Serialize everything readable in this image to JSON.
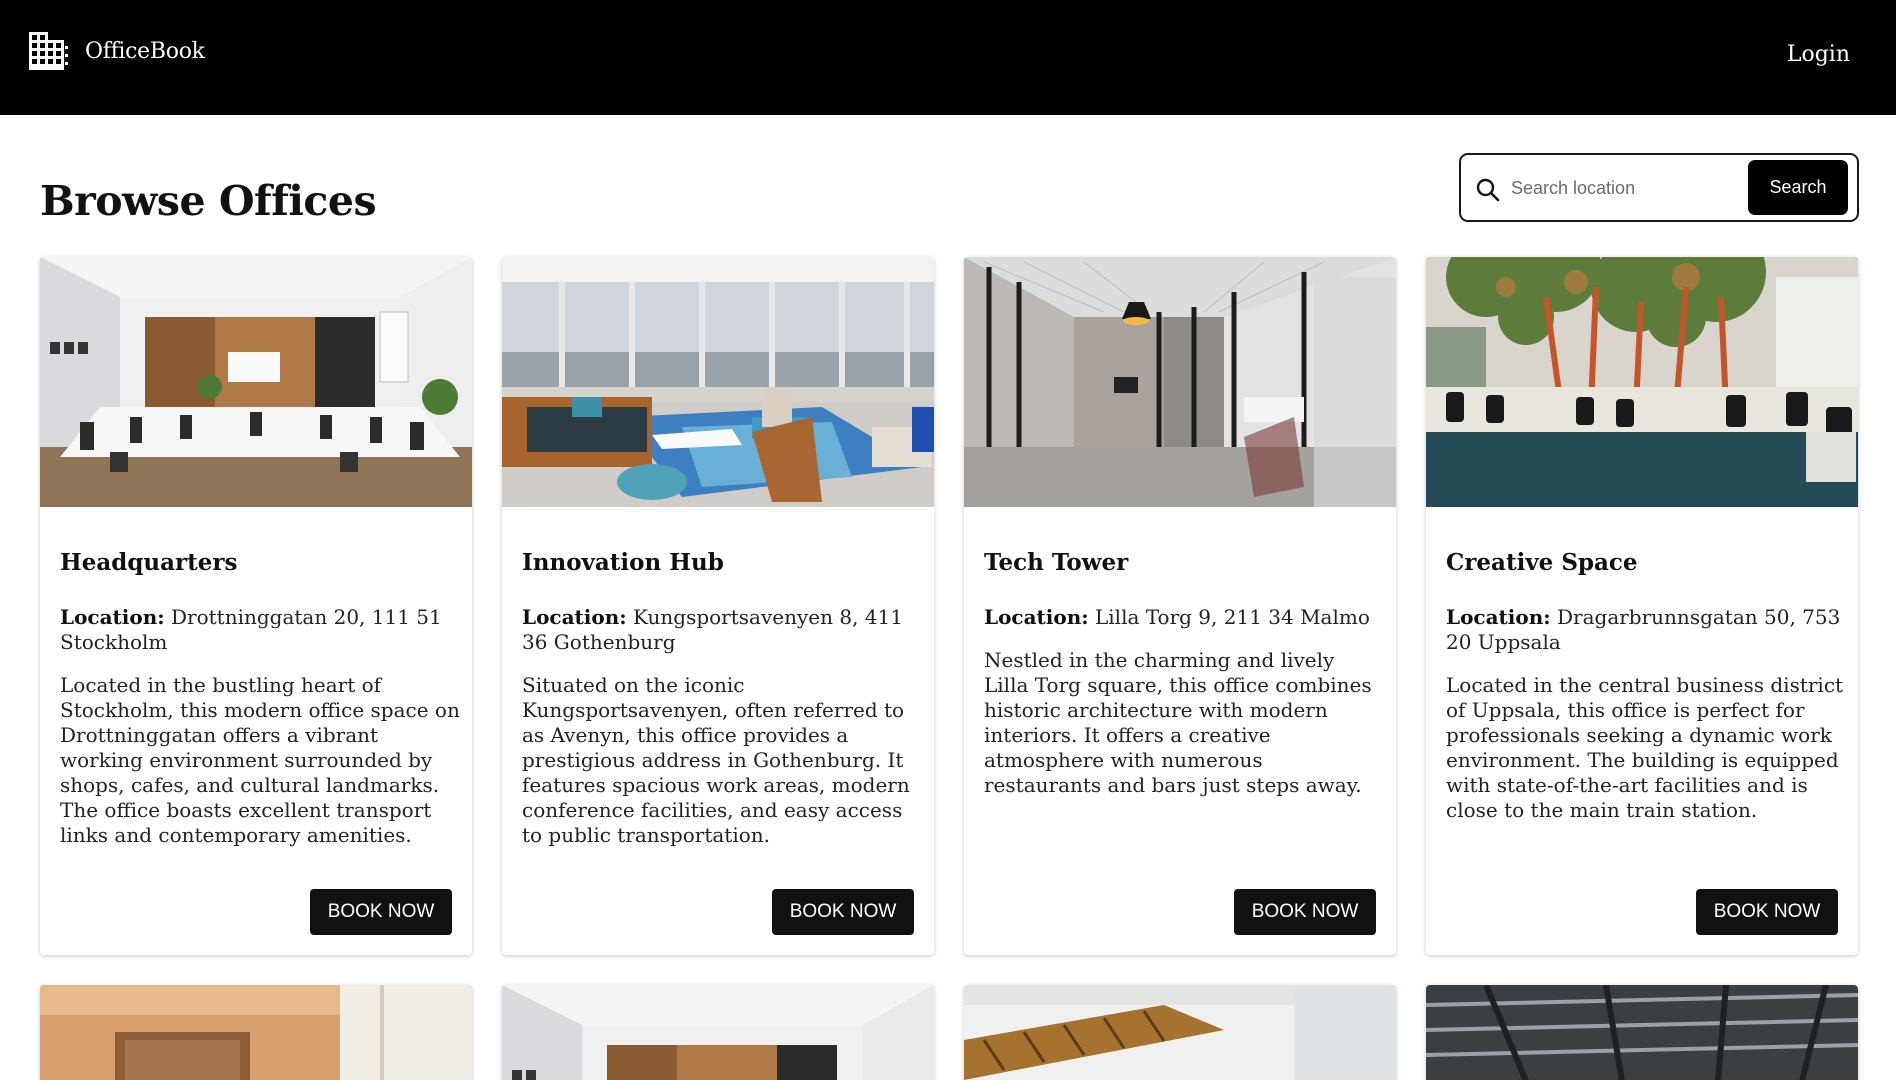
{
  "nav": {
    "brand": "OfficeBook",
    "login": "Login"
  },
  "page": {
    "title": "Browse Offices"
  },
  "search": {
    "placeholder": "Search location",
    "button": "Search"
  },
  "offices": [
    {
      "name": "Headquarters",
      "location_label": "Location:",
      "location": "Drottninggatan 20, 111 51 Stockholm",
      "description": "Located in the bustling heart of Stockholm, this modern office space on Drottninggatan offers a vibrant working environment surrounded by shops, cafes, and cultural landmarks. The office boasts excellent transport links and contemporary amenities.",
      "button": "BOOK NOW"
    },
    {
      "name": "Innovation Hub",
      "location_label": "Location:",
      "location": "Kungsportsavenyen 8, 411 36 Gothenburg",
      "description": "Situated on the iconic Kungsportsavenyen, often referred to as Avenyn, this office provides a prestigious address in Gothenburg. It features spacious work areas, modern conference facilities, and easy access to public transportation.",
      "button": "BOOK NOW"
    },
    {
      "name": "Tech Tower",
      "location_label": "Location:",
      "location": "Lilla Torg 9, 211 34 Malmo",
      "description": "Nestled in the charming and lively Lilla Torg square, this office combines historic architecture with modern interiors. It offers a creative atmosphere with numerous restaurants and bars just steps away.",
      "button": "BOOK NOW"
    },
    {
      "name": "Creative Space",
      "location_label": "Location:",
      "location": "Dragarbrunnsgatan 50, 753 20 Uppsala",
      "description": "Located in the central business district of Uppsala, this office is perfect for professionals seeking a dynamic work environment. The building is equipped with state-of-the-art facilities and is close to the main train station.",
      "button": "BOOK NOW"
    }
  ]
}
